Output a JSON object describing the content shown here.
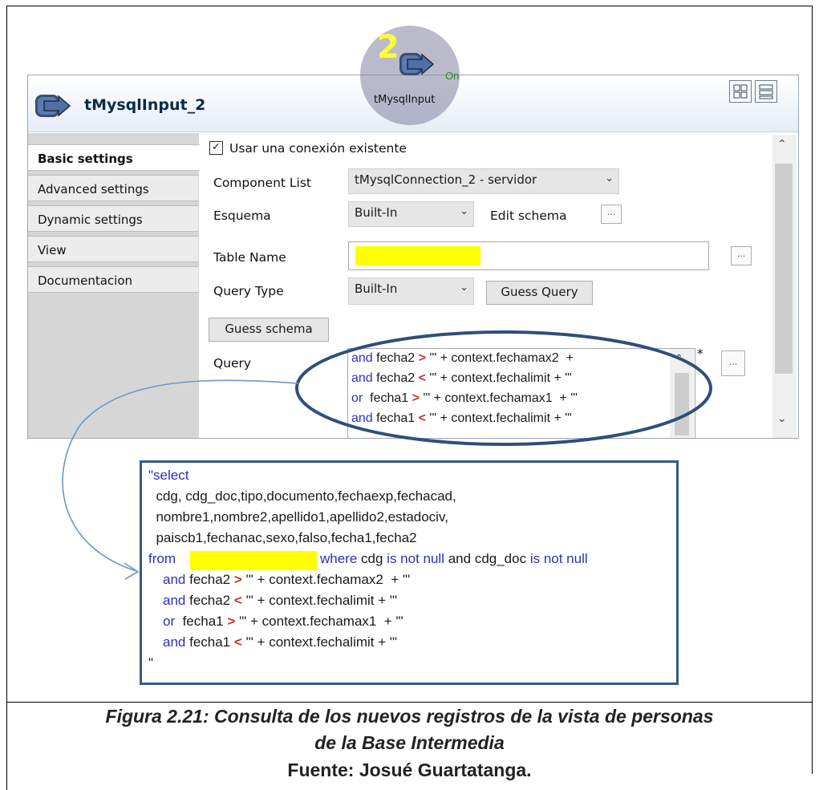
{
  "window": {
    "title": "tMysqlInput_2",
    "title_icon": "talend-component-icon",
    "layout_buttons": [
      "grid-layout-icon",
      "list-layout-icon"
    ]
  },
  "badge": {
    "number": "2",
    "label": "tMysqlInput",
    "connector": "On"
  },
  "tabs": [
    {
      "label": "Basic settings",
      "active": true
    },
    {
      "label": "Advanced settings",
      "active": false
    },
    {
      "label": "Dynamic settings",
      "active": false
    },
    {
      "label": "View",
      "active": false
    },
    {
      "label": "Documentacion",
      "active": false
    }
  ],
  "form": {
    "use_existing_connection": {
      "label": "Usar una conexión existente",
      "checked": true
    },
    "component_list": {
      "label": "Component List",
      "value": "tMysqlConnection_2 - servidor"
    },
    "schema": {
      "label": "Esquema",
      "value": "Built-In",
      "edit_label": "Edit schema"
    },
    "table_name": {
      "label": "Table Name",
      "value": ""
    },
    "query_type": {
      "label": "Query Type",
      "value": "Built-In",
      "guess_query_label": "Guess Query"
    },
    "guess_schema_label": "Guess schema",
    "query": {
      "label": "Query",
      "modified_marker": "*",
      "lines": [
        {
          "kw": "and",
          "rest": " fecha2 ",
          "op": ">",
          "tail": " '\" + context.fechamax2  + "
        },
        {
          "kw": "and",
          "rest": " fecha2 ",
          "op": "<",
          "tail": " '\" + context.fechalimit + \"'"
        },
        {
          "kw": "or",
          "rest": "  fecha1 ",
          "op": ">",
          "tail": " '\" + context.fechamax1  + \"'"
        },
        {
          "kw": "and",
          "rest": " fecha1 ",
          "op": "<",
          "tail": " '\" + context.fechalimit + \"'"
        }
      ]
    },
    "ellipsis": "..."
  },
  "code": {
    "line1": "\"select",
    "line2": "  cdg, cdg_doc,tipo,documento,fechaexp,fechacad,",
    "line3": "  nombre1,nombre2,apellido1,apellido2,estadociv,",
    "line4": "  paiscb1,fechanac,sexo,falso,fecha1,fecha2",
    "from_kw": "from",
    "where_kw": "where",
    "where_text": " cdg ",
    "is_not_null": "is not null",
    "and_text": " and ",
    "cdg_doc": "cdg_doc ",
    "lines": [
      {
        "kw": "and",
        "rest": " fecha2 ",
        "op": ">",
        "tail": " '\" + context.fechamax2  + \"'"
      },
      {
        "kw": "and",
        "rest": " fecha2 ",
        "op": "<",
        "tail": " '\" + context.fechalimit + \"'"
      },
      {
        "kw": "or",
        "rest": "  fecha1 ",
        "op": ">",
        "tail": " '\" + context.fechamax1  + \"'"
      },
      {
        "kw": "and",
        "rest": " fecha1 ",
        "op": "<",
        "tail": " '\" + context.fechalimit + \"'"
      }
    ],
    "closing": "\""
  },
  "caption": {
    "line1": "Figura 2.21: Consulta de los nuevos registros de la vista de personas",
    "line2": "de la Base Intermedia",
    "line3": "Fuente: Josué Guartatanga."
  },
  "colors": {
    "highlight": "#ffff00",
    "keyword": "#2f2fb8",
    "operator": "#c0392b",
    "annotation": "#345a80"
  }
}
